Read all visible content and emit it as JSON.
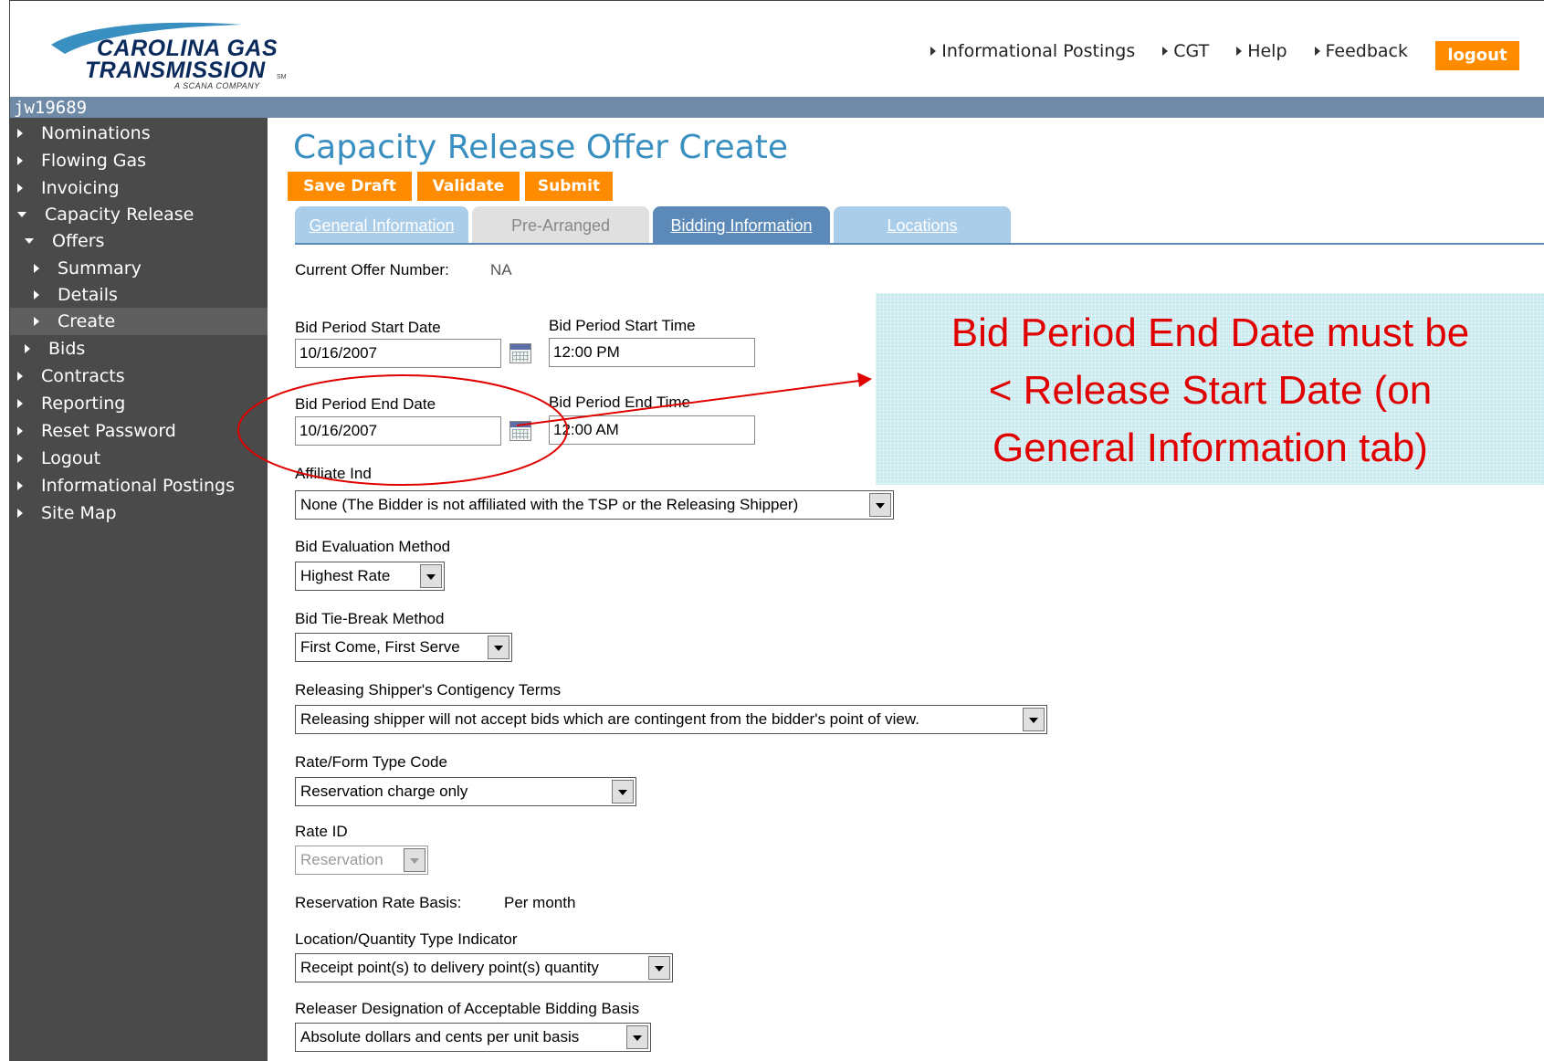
{
  "header": {
    "logo_line1": "CAROLINA GAS",
    "logo_line2": "TRANSMISSION",
    "logo_sm": "SM",
    "logo_sub": "A SCANA COMPANY",
    "nav": [
      "Informational Postings",
      "CGT",
      "Help",
      "Feedback"
    ],
    "logout_label": "logout"
  },
  "user": {
    "name": "jw19689"
  },
  "sidebar": {
    "items": [
      {
        "label": "Nominations",
        "state": "collapsed"
      },
      {
        "label": "Flowing Gas",
        "state": "collapsed"
      },
      {
        "label": "Invoicing",
        "state": "collapsed"
      },
      {
        "label": "Capacity Release",
        "state": "expanded"
      },
      {
        "label": "Offers",
        "state": "expanded"
      },
      {
        "label": "Summary",
        "state": "collapsed"
      },
      {
        "label": "Details",
        "state": "collapsed"
      },
      {
        "label": "Create",
        "state": "active"
      },
      {
        "label": "Bids",
        "state": "collapsed"
      },
      {
        "label": "Contracts",
        "state": "collapsed"
      },
      {
        "label": "Reporting",
        "state": "collapsed"
      },
      {
        "label": "Reset Password",
        "state": "collapsed"
      },
      {
        "label": "Logout",
        "state": "collapsed"
      },
      {
        "label": "Informational Postings",
        "state": "collapsed"
      },
      {
        "label": "Site Map",
        "state": "collapsed"
      }
    ]
  },
  "page": {
    "title": "Capacity Release Offer Create",
    "actions": [
      "Save Draft",
      "Validate",
      "Submit"
    ],
    "tabs": [
      "General Information",
      "Pre-Arranged",
      "Bidding Information",
      "Locations"
    ],
    "selected_tab": "Bidding Information"
  },
  "form": {
    "offer_number_label": "Current Offer Number:",
    "offer_number_value": "NA",
    "bid_start_date_label": "Bid Period Start Date",
    "bid_start_date_value": "10/16/2007",
    "bid_start_time_label": "Bid Period Start Time",
    "bid_start_time_value": "12:00 PM",
    "bid_end_date_label": "Bid Period End Date",
    "bid_end_date_value": "10/16/2007",
    "bid_end_time_label": "Bid Period End Time",
    "bid_end_time_value": "12:00 AM",
    "affiliate_label": "Affiliate Ind",
    "affiliate_value": "None (The Bidder is not affiliated with the TSP or the Releasing Shipper)",
    "eval_label": "Bid Evaluation Method",
    "eval_value": "Highest Rate",
    "tiebreak_label": "Bid Tie-Break Method",
    "tiebreak_value": "First Come, First Serve",
    "contingency_label": "Releasing Shipper's Contigency Terms",
    "contingency_value": "Releasing shipper will not accept bids which are contingent from the bidder's point of view.",
    "rateform_label": "Rate/Form Type Code",
    "rateform_value": "Reservation charge only",
    "rateid_label": "Rate ID",
    "rateid_value": "Reservation",
    "resbasis_label": "Reservation Rate Basis:",
    "resbasis_value": "Per month",
    "locqty_label": "Location/Quantity Type Indicator",
    "locqty_value": "Receipt point(s) to delivery point(s) quantity",
    "designation_label": "Releaser Designation of Acceptable Bidding Basis",
    "designation_value": "Absolute dollars and cents per unit basis"
  },
  "annotation": {
    "line1": "Bid Period End Date must be",
    "line2": "< Release Start Date (on",
    "line3": "General Information tab)",
    "color": "#e00000"
  },
  "colors": {
    "accent_orange": "#ff8c00",
    "title_blue": "#3a8fc1",
    "sidebar_bg": "#4a4a4a",
    "userbar_bg": "#6f8aa6"
  }
}
